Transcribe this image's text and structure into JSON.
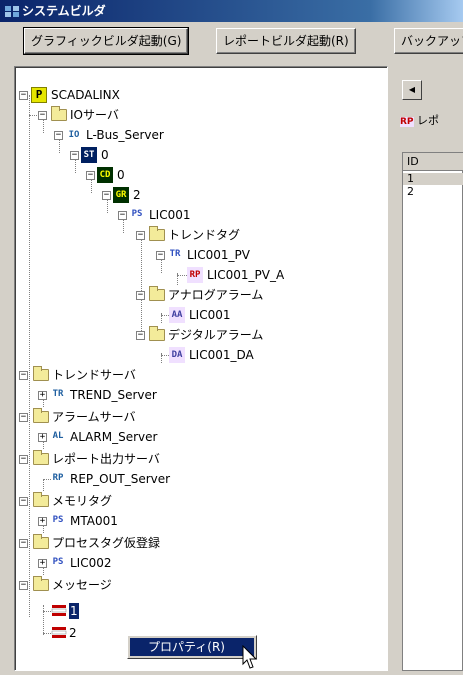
{
  "window": {
    "title": "システムビルダ"
  },
  "toolbar": {
    "graphic_builder": "グラフィックビルダ起動(G)",
    "report_builder": "レポートビルダ起動(R)",
    "backup": "バックアップ"
  },
  "tree": {
    "root": "SCADALINX",
    "io_server": "IOサーバ",
    "lbus": "L-Bus_Server",
    "st0": "0",
    "cd0": "0",
    "gr2": "2",
    "lic001": "LIC001",
    "trend_tag": "トレンドタグ",
    "lic001_pv": "LIC001_PV",
    "lic001_pv_a": "LIC001_PV_A",
    "analog_alarm": "アナログアラーム",
    "aa_lic001": "LIC001",
    "digital_alarm": "デジタルアラーム",
    "da_lic001": "LIC001_DA",
    "trend_server": "トレンドサーバ",
    "trend_server_item": "TREND_Server",
    "alarm_server": "アラームサーバ",
    "alarm_server_item": "ALARM_Server",
    "report_server": "レポート出力サーバ",
    "report_server_item": "REP_OUT_Server",
    "memory_tag": "メモリタグ",
    "mta001": "MTA001",
    "process_tag": "プロセスタグ仮登録",
    "lic002": "LIC002",
    "message": "メッセージ",
    "msg1": "1",
    "msg2": "2"
  },
  "right": {
    "tab": "レポ",
    "rp_badge": "RP",
    "col_id": "ID",
    "rows": [
      "1",
      "2"
    ]
  },
  "badges": {
    "st": "ST",
    "cd": "CD",
    "gr": "GR",
    "ps": "PS",
    "tr": "TR",
    "rp": "RP",
    "aa": "AA",
    "da": "DA",
    "io": "IO",
    "p": "P"
  },
  "context_menu": {
    "properties": "プロパティ(R)"
  },
  "colors": {
    "title_bar": "#0a246a",
    "selection": "#0a246a",
    "face": "#d4d0c8"
  }
}
